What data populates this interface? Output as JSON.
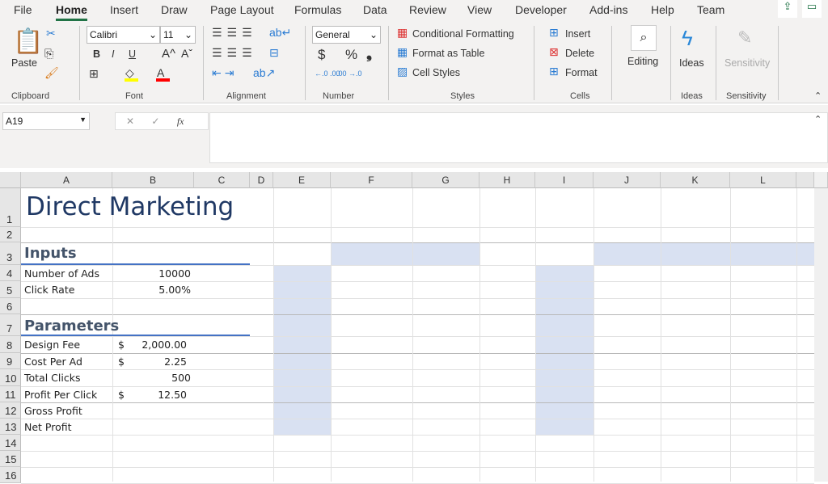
{
  "tabs": [
    "File",
    "Home",
    "Insert",
    "Draw",
    "Page Layout",
    "Formulas",
    "Data",
    "Review",
    "View",
    "Developer",
    "Add-ins",
    "Help",
    "Team"
  ],
  "active_tab": "Home",
  "ribbon": {
    "clipboard": {
      "paste": "Paste",
      "label": "Clipboard"
    },
    "font": {
      "name": "Calibri",
      "size": "11",
      "bold": "B",
      "italic": "I",
      "underline": "U",
      "grow": "A^",
      "shrink": "Aˇ",
      "color": "A",
      "label": "Font",
      "fill_color": "#ffff00",
      "font_color": "#ff0000"
    },
    "alignment": {
      "label": "Alignment"
    },
    "number": {
      "format": "General",
      "currency": "$",
      "percent": "%",
      "comma": "❟",
      "inc": "←.0 .00",
      "dec": ".00 →.0",
      "label": "Number"
    },
    "styles": {
      "conditional": "Conditional Formatting",
      "table": "Format as Table",
      "cell": "Cell Styles",
      "label": "Styles"
    },
    "cells": {
      "insert": "Insert",
      "delete": "Delete",
      "format": "Format",
      "label": "Cells"
    },
    "editing": {
      "label": "Editing"
    },
    "ideas": {
      "button": "Ideas",
      "label": "Ideas"
    },
    "sensitivity": {
      "button": "Sensitivity",
      "label": "Sensitivity"
    }
  },
  "formula_bar": {
    "name_box": "A19",
    "cancel": "✕",
    "enter": "✓",
    "fx": "fx",
    "value": ""
  },
  "columns": [
    "A",
    "B",
    "C",
    "D",
    "E",
    "F",
    "G",
    "H",
    "I",
    "J",
    "K",
    "L"
  ],
  "rows": [
    "1",
    "2",
    "3",
    "4",
    "5",
    "6",
    "7",
    "8",
    "9",
    "10",
    "11",
    "12",
    "13",
    "14",
    "15",
    "16"
  ],
  "sheet": {
    "title": "Direct Marketing",
    "inputs_header": "Inputs",
    "inputs": [
      {
        "label": "Number of Ads",
        "value": "10000"
      },
      {
        "label": "Click Rate",
        "value": "5.00%"
      }
    ],
    "parameters_header": "Parameters",
    "parameters": [
      {
        "label": "Design Fee",
        "currency": "$",
        "value": "2,000.00"
      },
      {
        "label": "Cost Per Ad",
        "currency": "$",
        "value": "2.25"
      },
      {
        "label": "Total Clicks",
        "currency": "",
        "value": "500"
      },
      {
        "label": "Profit Per Click",
        "currency": "$",
        "value": "12.50"
      },
      {
        "label": "Gross Profit",
        "currency": "",
        "value": ""
      },
      {
        "label": "Net Profit",
        "currency": "",
        "value": ""
      }
    ],
    "title_color": "#1f3864",
    "header_color": "#44546a",
    "accent": "#4472c4",
    "shade": "#d9e1f2"
  }
}
